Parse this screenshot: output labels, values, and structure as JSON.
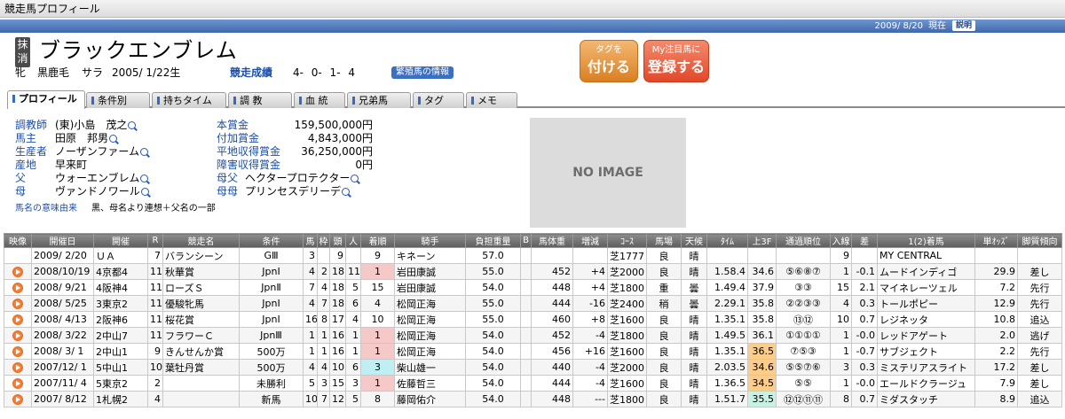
{
  "window": {
    "title": "競走馬プロフィール"
  },
  "datebar": {
    "date": "2009/ 8/20",
    "now": "現在",
    "help": "説明"
  },
  "horse": {
    "mark": "抹消",
    "name": "ブラックエンブレム",
    "sex": "牝",
    "coat": "黒鹿毛",
    "breed": "サラ",
    "birth": "2005/ 1/22生",
    "record_label": "競走成績",
    "record": "4- 0- 1- 4",
    "blood_button": "繁殖馬の情報"
  },
  "actions": {
    "tag_top": "タグを",
    "tag_bottom": "付ける",
    "fav_top": "My注目馬に",
    "fav_bottom": "登録する"
  },
  "tabs": [
    "プロフィール",
    "条件別",
    "持ちタイム",
    "調 教",
    "血 統",
    "兄弟馬",
    "タグ",
    "メモ"
  ],
  "profile": {
    "trainer_label": "調教師",
    "trainer": "(東)小島　茂之",
    "owner_label": "馬主",
    "owner": "田原　邦男",
    "breeder_label": "生産者",
    "breeder": "ノーザンファーム",
    "origin_label": "産地",
    "origin": "早来町",
    "sire_label": "父",
    "sire": "ウォーエンブレム",
    "dam_label": "母",
    "dam": "ヴァンドノワール",
    "meaning_label": "馬名の意味由来",
    "meaning": "黒、母名より連想＋父名の一部",
    "main_prize_label": "本賞金",
    "main_prize": "159,500,000円",
    "added_prize_label": "付加賞金",
    "added_prize": "4,843,000円",
    "flat_prize_label": "平地収得賞金",
    "flat_prize": "36,250,000円",
    "jump_prize_label": "障害収得賞金",
    "jump_prize": "0円",
    "dam_sire_label": "母父",
    "dam_sire": "ヘクタープロテクター",
    "dam_dam_label": "母母",
    "dam_dam": "プリンセスデリーデ",
    "no_image": "NO IMAGE"
  },
  "table": {
    "headers": [
      "映像",
      "開催日",
      "開催",
      "R",
      "競走名",
      "条件",
      "馬",
      "枠",
      "頭",
      "人",
      "着順",
      "騎手",
      "負担重量",
      "B",
      "馬体重",
      "増減",
      "ｺｰｽ",
      "馬場",
      "天候",
      "ﾀｲﾑ",
      "上3F",
      "通過順位",
      "入線",
      "差",
      "1(2)着馬",
      "単ｵｯｽﾞ",
      "脚質傾向"
    ],
    "rows": [
      [
        "",
        "2009/ 2/20",
        "ＵＡ",
        "7",
        "バランシーン",
        "GⅢ",
        "3",
        "",
        "9",
        "",
        "9",
        "キネーン",
        "57.0",
        "",
        "",
        "",
        "芝1777",
        "良",
        "晴",
        "",
        "",
        "",
        "9",
        "",
        "MY CENTRAL",
        "",
        ""
      ],
      [
        "▶",
        "2008/10/19",
        "4京都4",
        "11",
        "秋華賞",
        "JpnⅠ",
        "4",
        "2",
        "18",
        "11",
        "1",
        "岩田康誠",
        "55.0",
        "",
        "452",
        "+4",
        "芝2000",
        "良",
        "晴",
        "1.58.4",
        "34.6",
        "⑤⑥⑧⑦",
        "1",
        "-0.1",
        "ムードインディゴ",
        "29.9",
        "差し"
      ],
      [
        "▶",
        "2008/ 9/21",
        "4阪神4",
        "11",
        "ローズＳ",
        "JpnⅡ",
        "7",
        "4",
        "18",
        "5",
        "15",
        "岩田康誠",
        "54.0",
        "",
        "448",
        "+4",
        "芝1800",
        "重",
        "曇",
        "1.49.4",
        "37.9",
        "③③",
        "15",
        "2.1",
        "マイネレーツェル",
        "7.2",
        "先行"
      ],
      [
        "▶",
        "2008/ 5/25",
        "3東京2",
        "11",
        "優駿牝馬",
        "JpnⅠ",
        "4",
        "7",
        "18",
        "6",
        "4",
        "松岡正海",
        "55.0",
        "",
        "444",
        "-16",
        "芝2400",
        "稍",
        "曇",
        "2.29.1",
        "35.8",
        "②②③③",
        "4",
        "0.3",
        "トールポピー",
        "12.9",
        "先行"
      ],
      [
        "▶",
        "2008/ 4/13",
        "2阪神6",
        "11",
        "桜花賞",
        "JpnⅠ",
        "16",
        "8",
        "17",
        "4",
        "10",
        "松岡正海",
        "55.0",
        "",
        "460",
        "+8",
        "芝1600",
        "良",
        "晴",
        "1.35.1",
        "35.8",
        "⑬⑫",
        "10",
        "0.7",
        "レジネッタ",
        "10.8",
        "追込"
      ],
      [
        "▶",
        "2008/ 3/22",
        "2中山7",
        "11",
        "フラワーＣ",
        "JpnⅢ",
        "1",
        "1",
        "16",
        "1",
        "1",
        "松岡正海",
        "54.0",
        "",
        "452",
        "-4",
        "芝1800",
        "良",
        "晴",
        "1.49.5",
        "36.1",
        "①①①①",
        "1",
        "-0.0",
        "レッドアゲート",
        "2.0",
        "逃げ"
      ],
      [
        "▶",
        "2008/ 3/ 1",
        "2中山1",
        "9",
        "きんせんか賞",
        "500万",
        "1",
        "1",
        "16",
        "1",
        "1",
        "松岡正海",
        "54.0",
        "",
        "456",
        "+16",
        "芝1600",
        "良",
        "晴",
        "1.35.1",
        "36.5",
        "⑦⑤③",
        "1",
        "-0.7",
        "サブジェクト",
        "2.2",
        "先行"
      ],
      [
        "▶",
        "2007/12/ 1",
        "5中山1",
        "10",
        "葉牡丹賞",
        "500万",
        "4",
        "4",
        "10",
        "6",
        "3",
        "柴山雄一",
        "54.0",
        "",
        "440",
        "-4",
        "芝2000",
        "良",
        "晴",
        "2.03.5",
        "34.6",
        "⑤⑤⑦⑥",
        "3",
        "0.3",
        "ミステリアスライト",
        "17.2",
        "差し"
      ],
      [
        "▶",
        "2007/11/ 4",
        "5東京2",
        "2",
        "",
        "未勝利",
        "5",
        "3",
        "15",
        "3",
        "1",
        "佐藤哲三",
        "54.0",
        "",
        "444",
        "-4",
        "芝1600",
        "良",
        "晴",
        "1.36.5",
        "34.5",
        "⑤⑤",
        "1",
        "-0.0",
        "エールドクラージュ",
        "7.9",
        "差し"
      ],
      [
        "▶",
        "2007/ 8/12",
        "1札幌2",
        "4",
        "",
        "新馬",
        "10",
        "7",
        "12",
        "5",
        "8",
        "藤岡佑介",
        "54.0",
        "",
        "448",
        "---",
        "芝1800",
        "良",
        "晴",
        "1.51.7",
        "35.5",
        "⑫⑫⑪⑪",
        "8",
        "0.7",
        "ミダスタッチ",
        "8.9",
        "追込"
      ]
    ]
  }
}
